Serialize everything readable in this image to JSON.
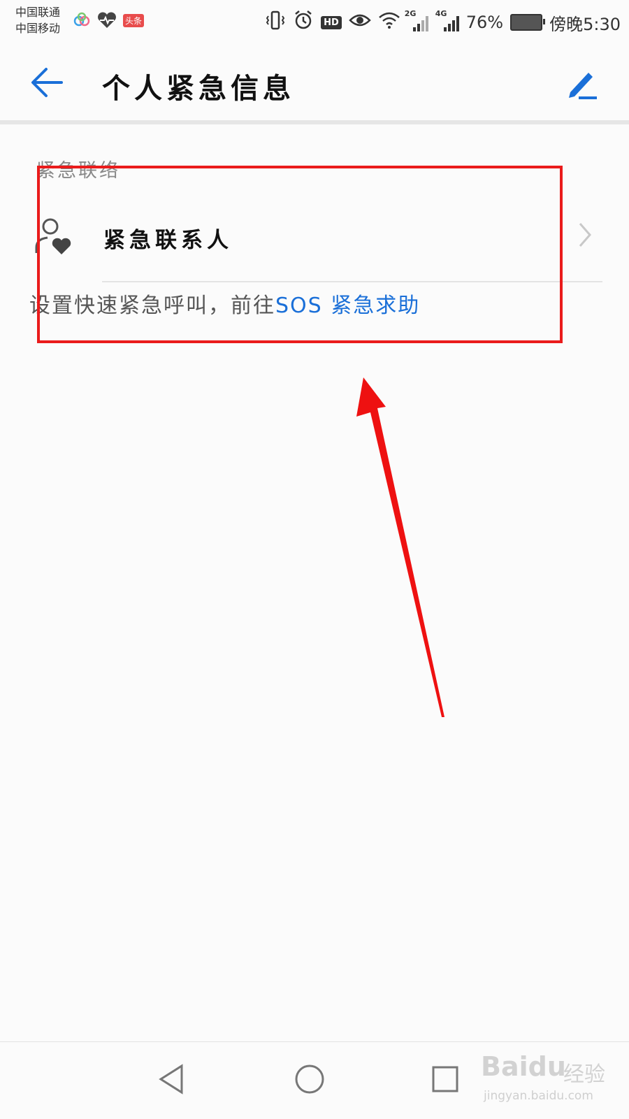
{
  "status_bar": {
    "carrier_1": "中国联通",
    "carrier_2": "中国移动",
    "app_badge": "头条",
    "net_1": "2G",
    "net_2": "4G",
    "battery": "76%",
    "time": "傍晚5:30"
  },
  "header": {
    "back_icon": "arrow-left-icon",
    "title": "个人紧急信息",
    "edit_icon": "pencil-icon"
  },
  "section": {
    "title": "紧急联络",
    "contact_item": {
      "icon": "person-heart-icon",
      "label": "紧急联系人"
    },
    "sos_prefix": "设置快速紧急呼叫，前往",
    "sos_link": "SOS 紧急求助"
  },
  "nav_bar": {
    "back": "triangle-back-icon",
    "home": "circle-home-icon",
    "recents": "square-recents-icon"
  },
  "watermark": {
    "logo": "Baidu",
    "brand": "经验",
    "url": "jingyan.baidu.com"
  },
  "colors": {
    "accent": "#1a6fd8",
    "annotation": "#ea1b1b",
    "background": "#fbfbfb"
  }
}
